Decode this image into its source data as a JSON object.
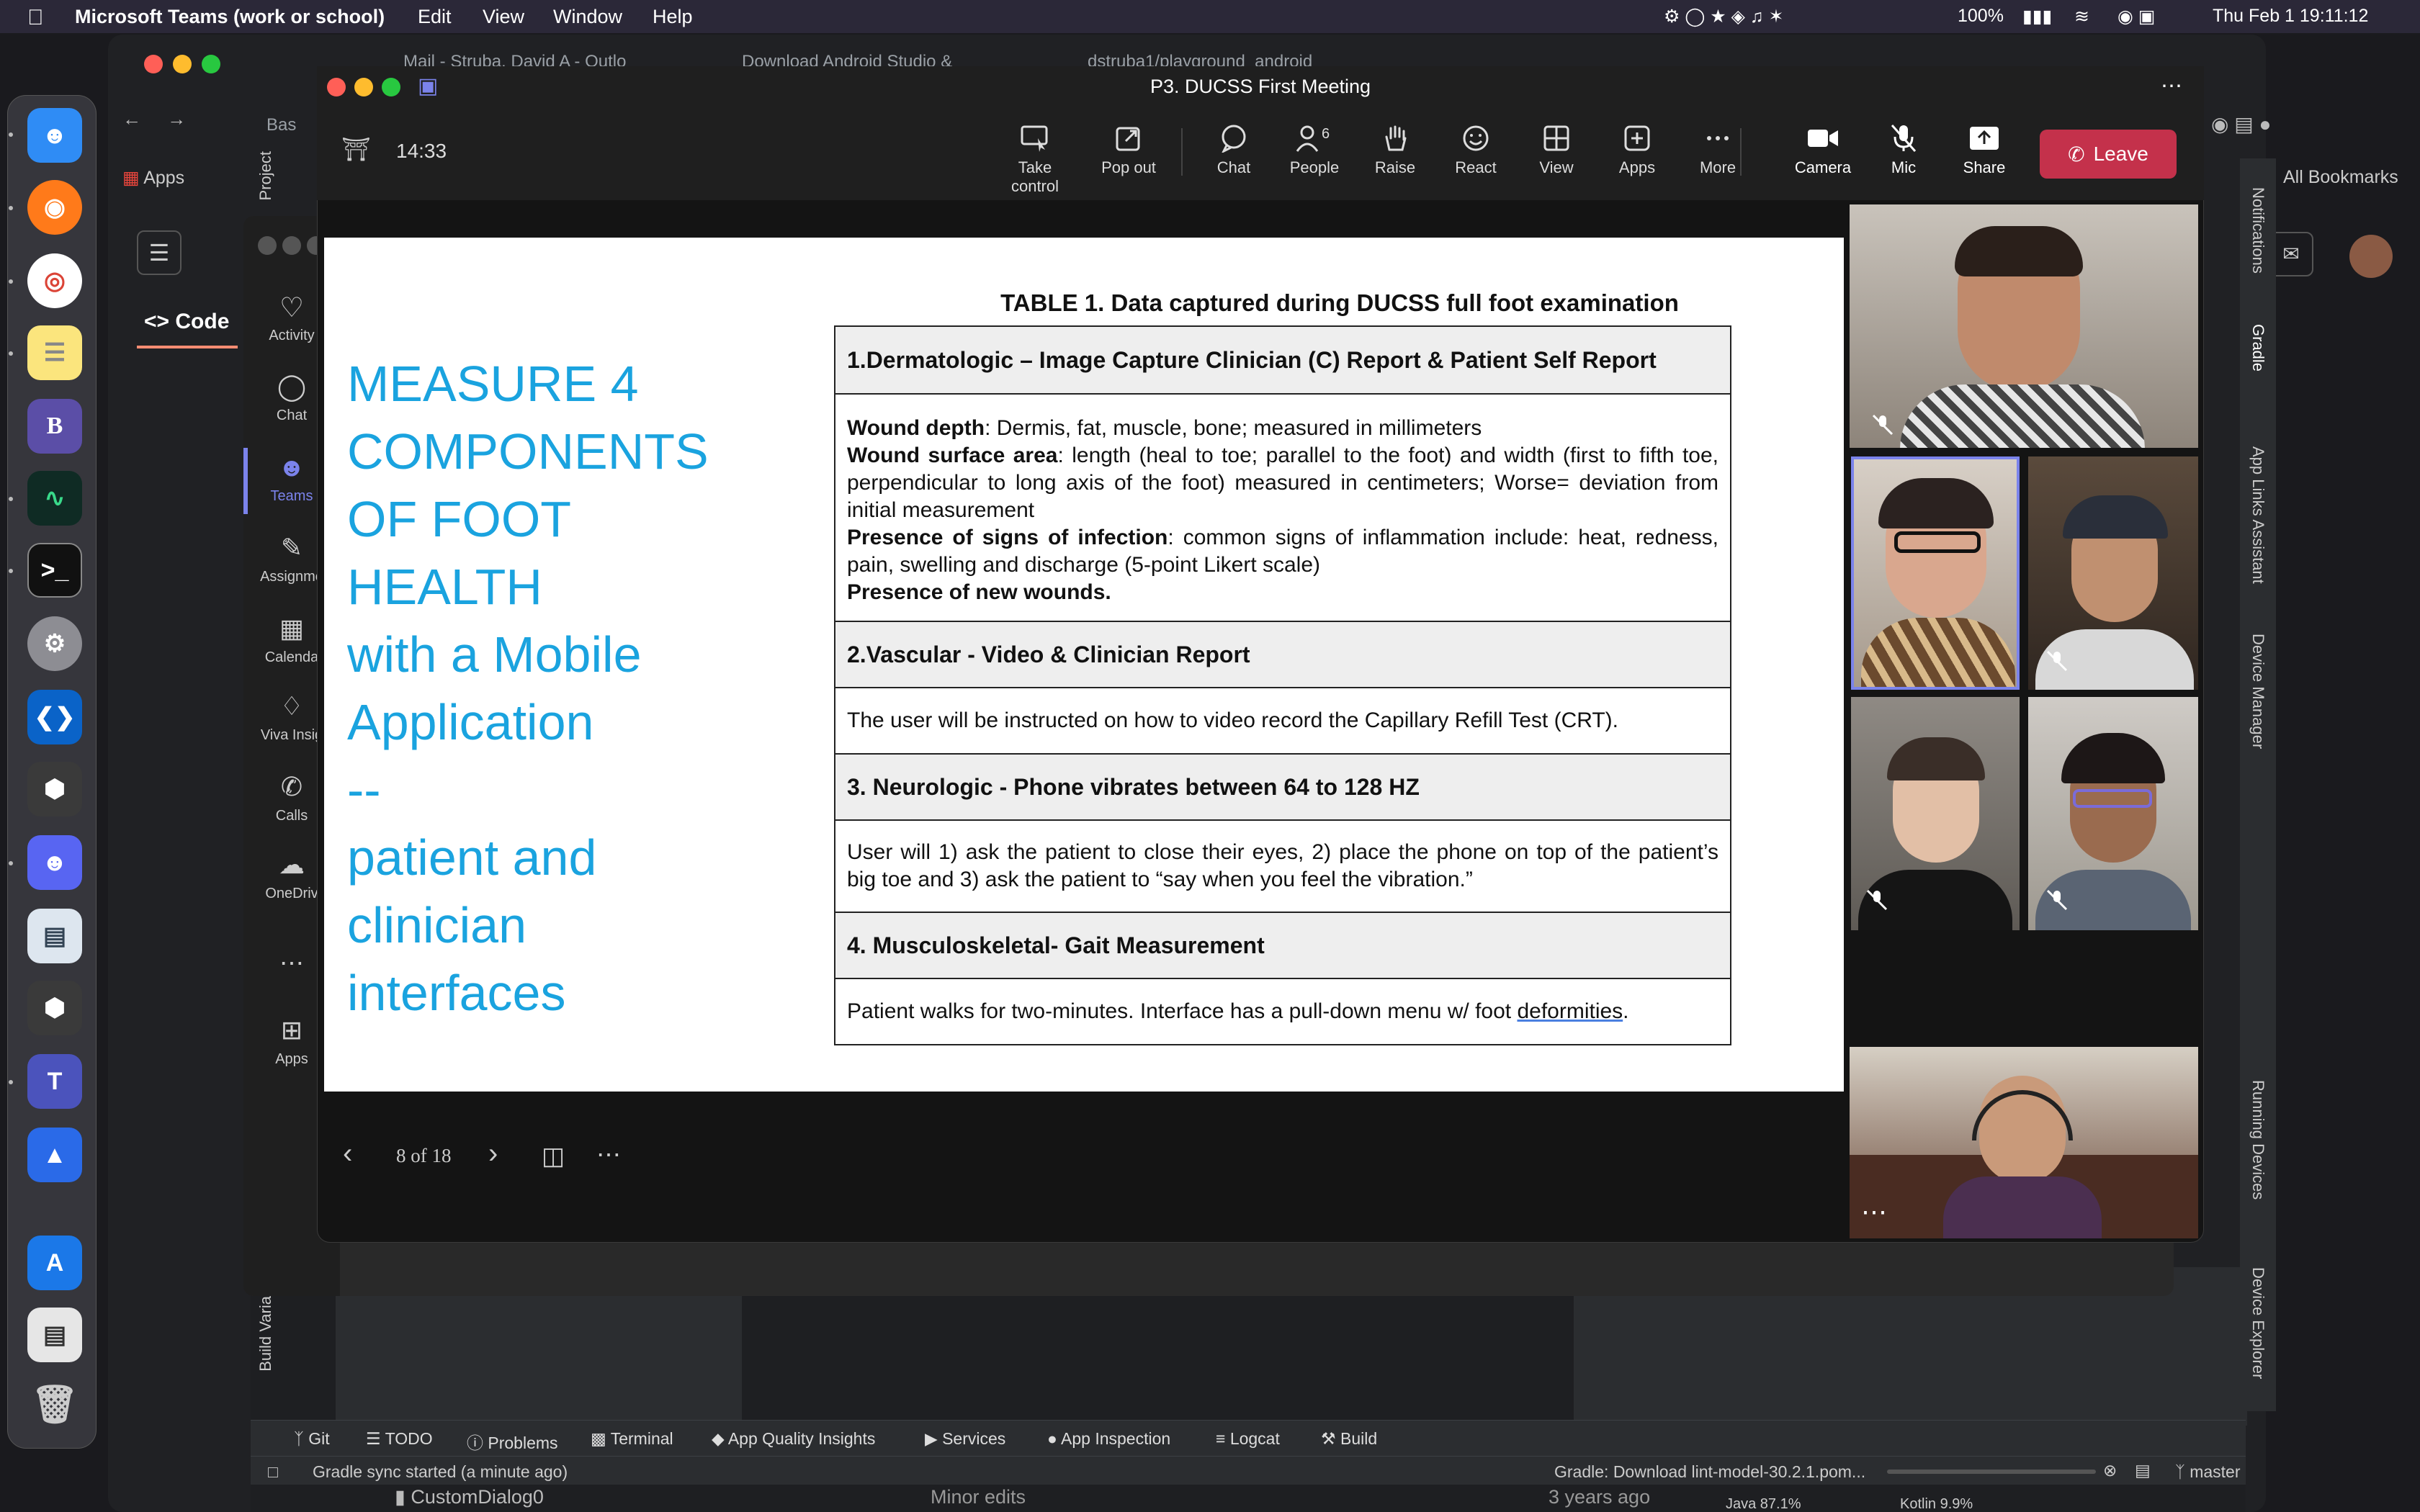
{
  "menubar": {
    "app": "Microsoft Teams (work or school)",
    "items": [
      "Edit",
      "View",
      "Window",
      "Help"
    ],
    "battery": "100%",
    "clock": "Thu Feb 1  19:11:12"
  },
  "browser": {
    "tabs": [
      "Mail - Struba, David A - Outlo",
      "Download Android Studio &",
      "dstruba1/playground_android"
    ],
    "apps_label": "Apps",
    "all_bookmarks": "All Bookmarks",
    "code_tab": "Code",
    "bas_label": "Bas"
  },
  "teams_rail": {
    "items": [
      "Activity",
      "Chat",
      "Teams",
      "Assignme",
      "Calenda",
      "Viva Insig",
      "Calls",
      "OneDriv",
      "Apps"
    ]
  },
  "meeting": {
    "title": "P3. DUCSS First Meeting",
    "timer": "14:33",
    "buttons": {
      "take_control": "Take control",
      "pop_out": "Pop out",
      "chat": "Chat",
      "people": "People",
      "people_count": "6",
      "raise": "Raise",
      "react": "React",
      "view": "View",
      "apps": "Apps",
      "more": "More",
      "camera": "Camera",
      "mic": "Mic",
      "share": "Share",
      "leave": "Leave"
    },
    "slide_nav": "8 of 18"
  },
  "slide": {
    "title_lines": [
      "MEASURE 4",
      "COMPONENTS",
      "OF FOOT HEALTH",
      "with a Mobile",
      "Application",
      "--",
      "patient and",
      "clinician",
      "interfaces"
    ],
    "table_caption": "TABLE 1. Data captured during DUCSS full foot examination",
    "sections": [
      {
        "header": "1.Dermatologic – Image Capture Clinician (C) Report & Patient Self Report",
        "b1": "Wound depth",
        "t1": ": Dermis, fat, muscle, bone; measured in millimeters",
        "b2": "Wound surface area",
        "t2": ": length (heal to toe; parallel to the foot) and width (first to fifth toe, perpendicular to long axis of the foot) measured in centimeters; Worse= deviation from initial measurement",
        "b3": "Presence of signs of infection",
        "t3": ": common signs of inflammation include: heat, redness, pain, swelling and discharge (5-point Likert scale)",
        "b4": "Presence of new wounds."
      },
      {
        "header": "2.Vascular - Video & Clinician Report",
        "body": "The user will be instructed on how to video record the Capillary Refill Test (CRT)."
      },
      {
        "header": "3. Neurologic - Phone vibrates between 64 to 128 HZ",
        "body": "User will 1) ask the patient to close their eyes, 2) place the phone on top of the patient’s big toe and 3) ask the patient to “say when you feel the vibration.”"
      },
      {
        "header": "4. Musculoskeletal- Gait Measurement",
        "body_pre": "Patient walks for two-minutes. Interface has a pull-down menu w/ foot ",
        "body_link": "deformities",
        "body_post": "."
      }
    ]
  },
  "studio": {
    "tools": [
      "Git",
      "TODO",
      "Problems",
      "Terminal",
      "App Quality Insights",
      "Services",
      "App Inspection",
      "Logcat",
      "Build"
    ],
    "status_left": "Gradle sync started (a minute ago)",
    "status_right": "Gradle: Download lint-model-30.2.1.pom...",
    "branch": "master",
    "file_name": "CustomDialog0",
    "commit_msg": "Minor edits",
    "commit_age": "3 years ago",
    "lang1": "Java 87.1%",
    "lang2": "Kotlin 9.9%",
    "side_labels": [
      "Notifications",
      "Gradle",
      "App Links Assistant",
      "Device Manager",
      "Running Devices",
      "Device Explorer"
    ],
    "left_labels": [
      "Project",
      "Build Varia"
    ]
  },
  "colors": {
    "accent_blue": "#1aa3df",
    "leave_red": "#c4314b",
    "active_tile": "#7b83eb"
  }
}
